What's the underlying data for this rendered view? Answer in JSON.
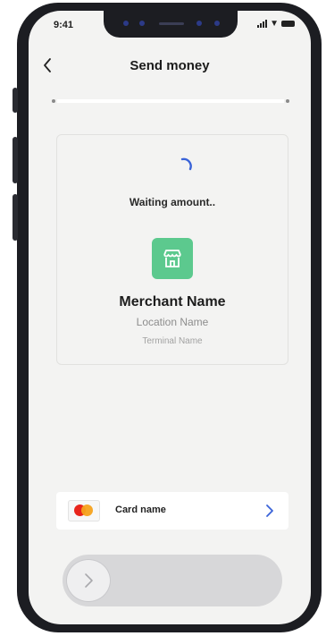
{
  "status_bar": {
    "time": "9:41"
  },
  "header": {
    "title": "Send money"
  },
  "merchant": {
    "status_text": "Waiting amount..",
    "name": "Merchant Name",
    "location": "Location Name",
    "terminal": "Terminal Name"
  },
  "payment_card": {
    "label": "Card name",
    "brand_icon": "mastercard-icon"
  },
  "colors": {
    "spinner_accent": "#3a63d8",
    "merchant_badge": "#5cc98e",
    "chevron": "#3a63d8"
  }
}
